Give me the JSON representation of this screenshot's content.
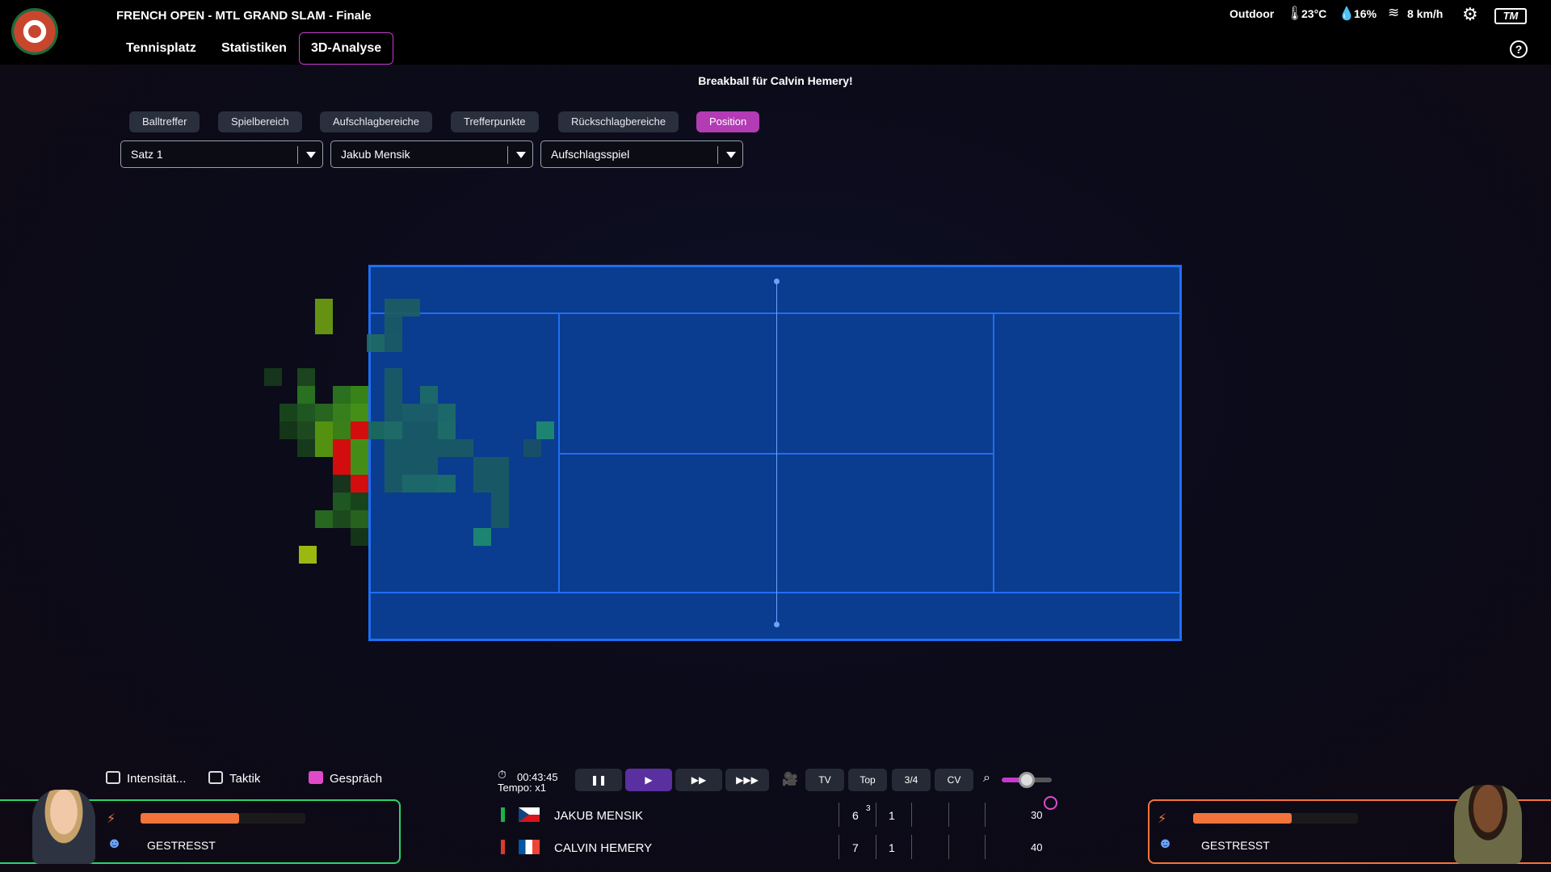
{
  "header": {
    "tournament": "FRENCH OPEN - MTL GRAND SLAM - Finale",
    "tabs": [
      "Tennisplatz",
      "Statistiken",
      "3D-Analyse"
    ],
    "active_tab": "3D-Analyse",
    "weather": {
      "condition": "Outdoor",
      "temperature": "23°C",
      "humidity": "16%",
      "wind": "8 km/h"
    },
    "brand": "TM"
  },
  "message": "Breakball für Calvin Hemery!",
  "filters": {
    "chips": [
      "Balltreffer",
      "Spielbereich",
      "Aufschlagbereiche",
      "Trefferpunkte",
      "Rückschlagbereiche",
      "Position"
    ],
    "active_chip": "Position",
    "dropdowns": {
      "set": "Satz 1",
      "player": "Jakub Mensik",
      "type": "Aufschlagsspiel"
    }
  },
  "actions": [
    "Intensität...",
    "Taktik",
    "Gespräch"
  ],
  "playback": {
    "time": "00:43:45",
    "tempo": "Tempo: x1",
    "cameras": [
      "TV",
      "Top",
      "3/4",
      "CV"
    ]
  },
  "scoreboard": [
    {
      "name": "JAKUB MENSIK",
      "set1": "6",
      "tiebreak": "3",
      "set2": "1",
      "points": "30",
      "color": "#1db14a"
    },
    {
      "name": "CALVIN HEMERY",
      "set1": "7",
      "tiebreak": "",
      "set2": "1",
      "points": "40",
      "color": "#d93a2e"
    }
  ],
  "players": {
    "left": {
      "status": "GESTRESST",
      "bar_fraction": 0.6,
      "accent": "#2bd46a"
    },
    "right": {
      "status": "GESTRESST",
      "bar_fraction": 0.6,
      "accent": "#f2743a"
    }
  }
}
